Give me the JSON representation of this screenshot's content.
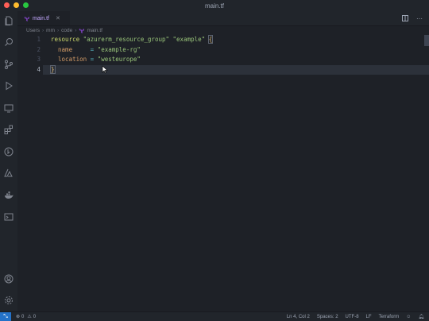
{
  "window": {
    "title": "main.tf"
  },
  "tab": {
    "label": "main.tf",
    "close": "✕"
  },
  "breadcrumb": [
    "Users",
    "mm",
    "code",
    "main.tf"
  ],
  "editor": {
    "line_numbers": [
      "1",
      "2",
      "3",
      "4"
    ],
    "lines": [
      [
        {
          "t": "resource",
          "c": "kw"
        },
        {
          "t": " ",
          "c": ""
        },
        {
          "t": "\"azurerm_resource_group\"",
          "c": "str"
        },
        {
          "t": " ",
          "c": ""
        },
        {
          "t": "\"example\"",
          "c": "str"
        },
        {
          "t": " ",
          "c": ""
        },
        {
          "t": "{",
          "c": "brace"
        }
      ],
      [
        {
          "t": "  name",
          "c": "attr"
        },
        {
          "t": "     ",
          "c": ""
        },
        {
          "t": "=",
          "c": "op"
        },
        {
          "t": " ",
          "c": ""
        },
        {
          "t": "\"example-rg\"",
          "c": "str"
        }
      ],
      [
        {
          "t": "  location",
          "c": "attr"
        },
        {
          "t": " ",
          "c": ""
        },
        {
          "t": "=",
          "c": "op"
        },
        {
          "t": " ",
          "c": ""
        },
        {
          "t": "\"westeurope\"",
          "c": "str"
        }
      ],
      [
        {
          "t": "}",
          "c": "brace"
        }
      ]
    ]
  },
  "status": {
    "errors": "0",
    "warnings": "0",
    "position": "Ln 4, Col 2",
    "spaces": "Spaces: 2",
    "encoding": "UTF-8",
    "eol": "LF",
    "language": "Terraform"
  },
  "colors": {
    "accent": "#2472c8",
    "terraform_icon": "#7b42bc"
  }
}
